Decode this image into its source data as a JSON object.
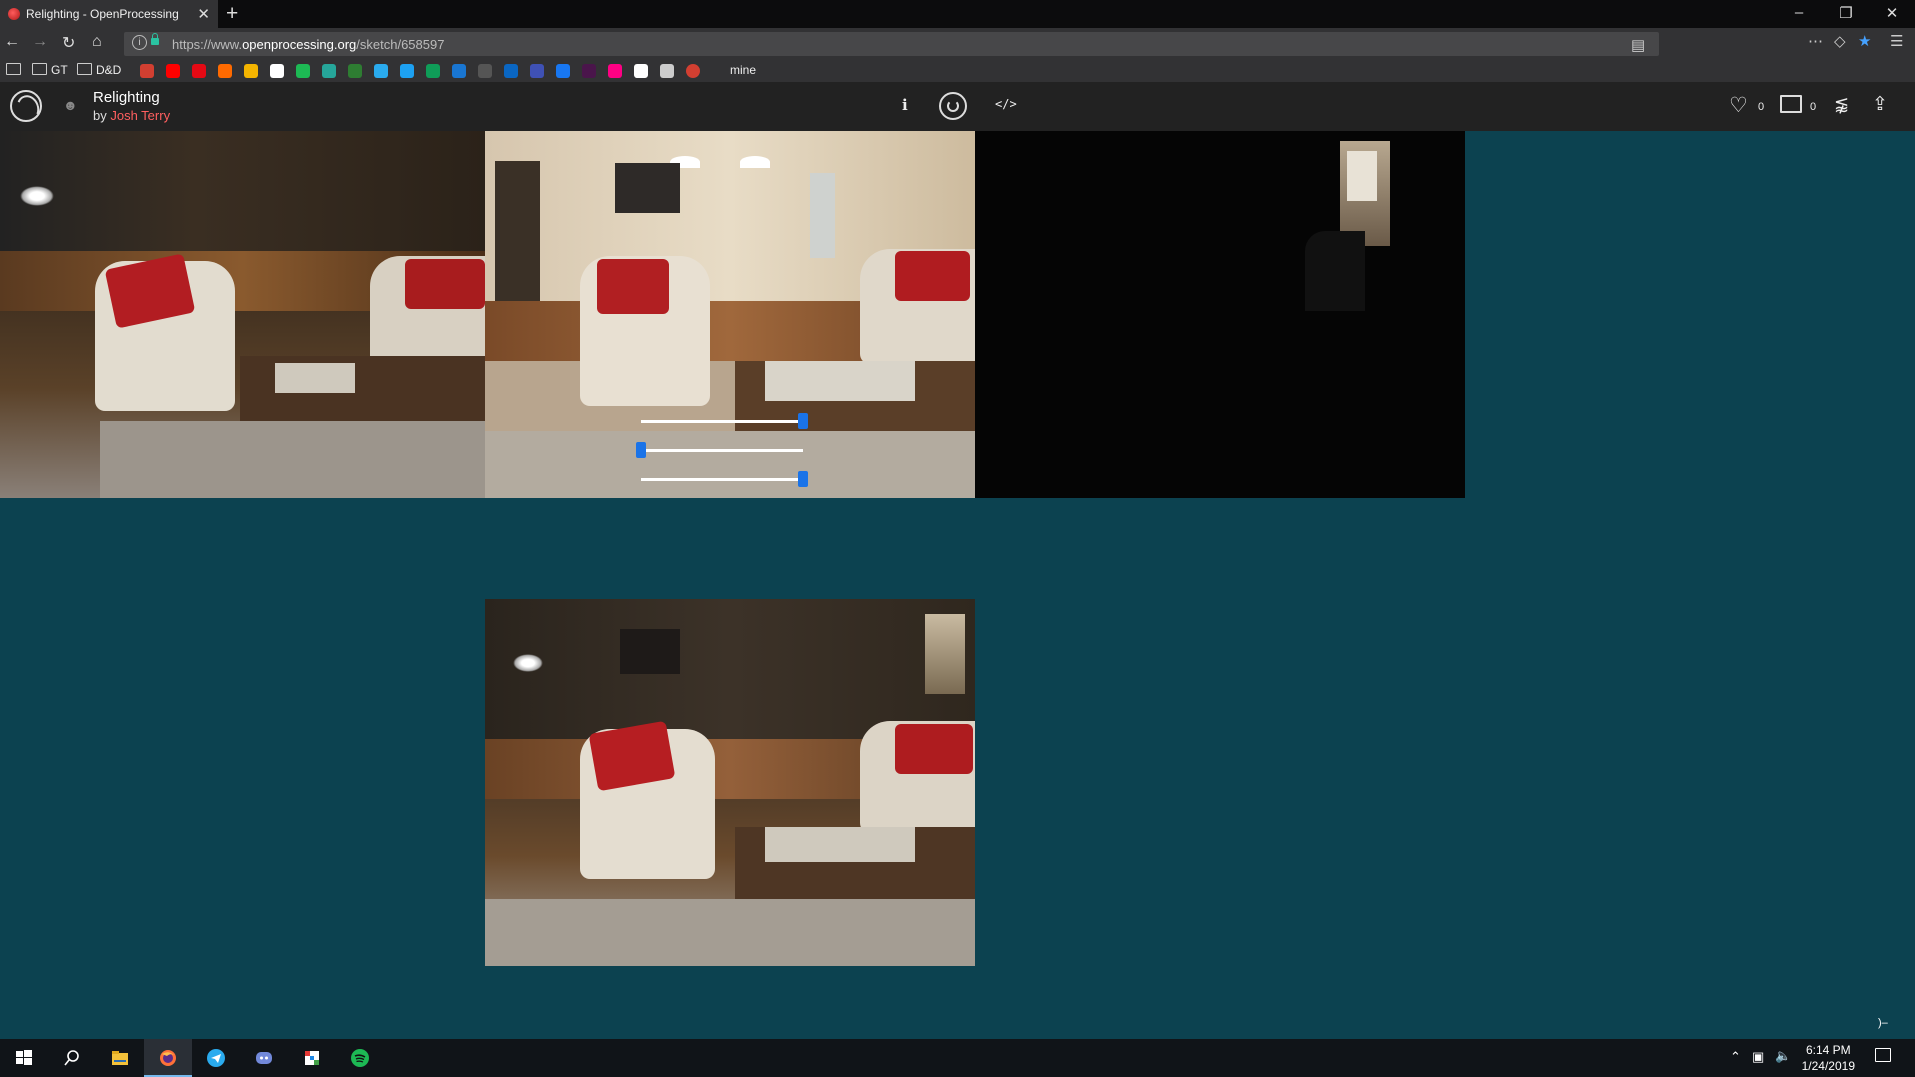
{
  "browser": {
    "tab_title": "Relighting - OpenProcessing",
    "tab_close": "✕",
    "new_tab": "+",
    "url_prefix": "https://www.",
    "url_domain": "openprocessing.org",
    "url_path": "/sketch/658597",
    "window_controls": {
      "minimize": "–",
      "restore": "❐",
      "close": "✕"
    },
    "bookmarks": {
      "folders": [
        "GT",
        "D&D"
      ],
      "mine_label": "mine",
      "icon_colors": [
        "#d23f31",
        "#ff0000",
        "#e50914",
        "#ff6a00",
        "#f4b400",
        "#ffffff",
        "#1db954",
        "#26a69a",
        "#2e7d32",
        "#2aabee",
        "#1da1f2",
        "#0f9d58",
        "#1976d2",
        "#555555",
        "#0a66c2",
        "#3f51b5",
        "#1877f2",
        "#4a154b",
        "#ff0084",
        "#ffffff",
        "#cccccc",
        "#d23f31"
      ]
    }
  },
  "sketch": {
    "title": "Relighting",
    "by_prefix": "by ",
    "author": "Josh Terry",
    "info_label": "i",
    "code_label": "</>",
    "likes": "0",
    "comments": "0"
  },
  "sliders": [
    {
      "value": 1.0
    },
    {
      "value": 0.0
    },
    {
      "value": 1.0
    }
  ],
  "taskbar": {
    "time": "6:14 PM",
    "date": "1/24/2019"
  },
  "colors": {
    "canvas_bg": "#0c4250",
    "accent_red": "#ff5f5f",
    "slider_thumb": "#1a73e8"
  }
}
